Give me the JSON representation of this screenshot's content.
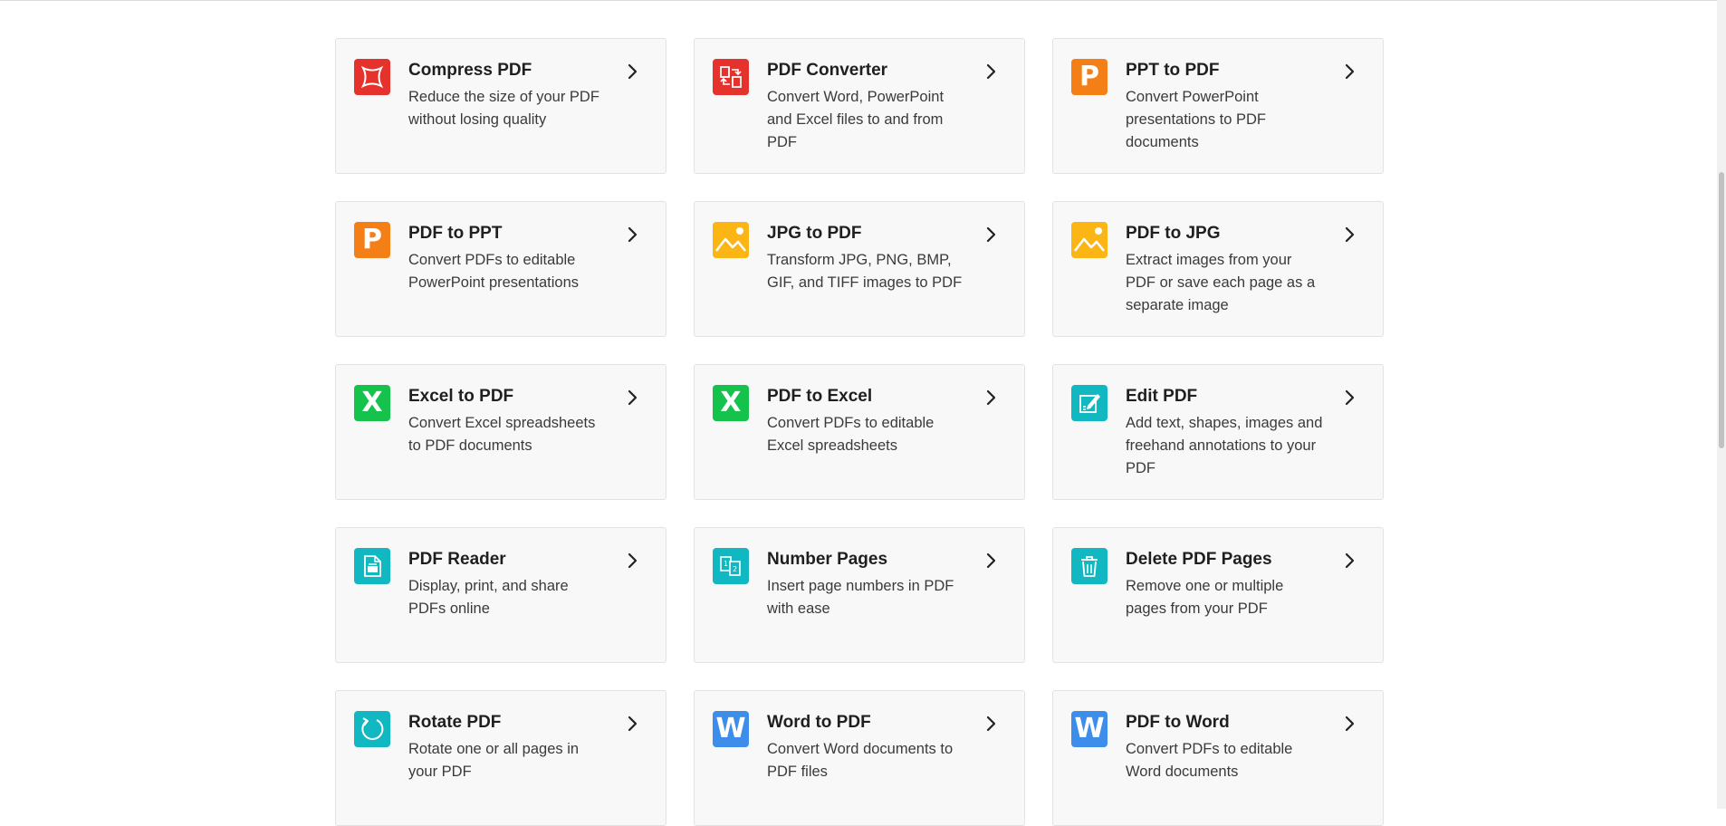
{
  "colors": {
    "red": "#e5322d",
    "orange": "#f57f17",
    "yellow": "#fbb515",
    "green": "#14c24c",
    "teal": "#11b8c2",
    "blue": "#3d8eea"
  },
  "tools": [
    {
      "title": "Compress PDF",
      "desc": "Reduce the size of your PDF without losing quality",
      "icon": "compress-icon",
      "color": "#e5322d"
    },
    {
      "title": "PDF Converter",
      "desc": "Convert Word, PowerPoint and Excel files to and from PDF",
      "icon": "convert-icon",
      "color": "#e5322d"
    },
    {
      "title": "PPT to PDF",
      "desc": "Convert PowerPoint presentations to PDF documents",
      "icon": "powerpoint-icon",
      "color": "#f57f17",
      "letter": "P"
    },
    {
      "title": "PDF to PPT",
      "desc": "Convert PDFs to editable PowerPoint presentations",
      "icon": "powerpoint-icon",
      "color": "#f57f17",
      "letter": "P"
    },
    {
      "title": "JPG to PDF",
      "desc": "Transform JPG, PNG, BMP, GIF, and TIFF images to PDF",
      "icon": "image-icon",
      "color": "#fbb515"
    },
    {
      "title": "PDF to JPG",
      "desc": "Extract images from your PDF or save each page as a separate image",
      "icon": "image-icon",
      "color": "#fbb515"
    },
    {
      "title": "Excel to PDF",
      "desc": "Convert Excel spreadsheets to PDF documents",
      "icon": "excel-icon",
      "color": "#14c24c",
      "letter": "X"
    },
    {
      "title": "PDF to Excel",
      "desc": "Convert PDFs to editable Excel spreadsheets",
      "icon": "excel-icon",
      "color": "#14c24c",
      "letter": "X"
    },
    {
      "title": "Edit PDF",
      "desc": "Add text, shapes, images and freehand annotations to your PDF",
      "icon": "edit-icon",
      "color": "#11b8c2"
    },
    {
      "title": "PDF Reader",
      "desc": "Display, print, and share PDFs online",
      "icon": "reader-icon",
      "color": "#11b8c2"
    },
    {
      "title": "Number Pages",
      "desc": "Insert page numbers in PDF with ease",
      "icon": "number-pages-icon",
      "color": "#11b8c2"
    },
    {
      "title": "Delete PDF Pages",
      "desc": "Remove one or multiple pages from your PDF",
      "icon": "trash-icon",
      "color": "#11b8c2"
    },
    {
      "title": "Rotate PDF",
      "desc": "Rotate one or all pages in your PDF",
      "icon": "rotate-icon",
      "color": "#11b8c2"
    },
    {
      "title": "Word to PDF",
      "desc": "Convert Word documents to PDF files",
      "icon": "word-icon",
      "color": "#3d8eea",
      "letter": "W"
    },
    {
      "title": "PDF to Word",
      "desc": "Convert PDFs to editable Word documents",
      "icon": "word-icon",
      "color": "#3d8eea",
      "letter": "W"
    }
  ]
}
